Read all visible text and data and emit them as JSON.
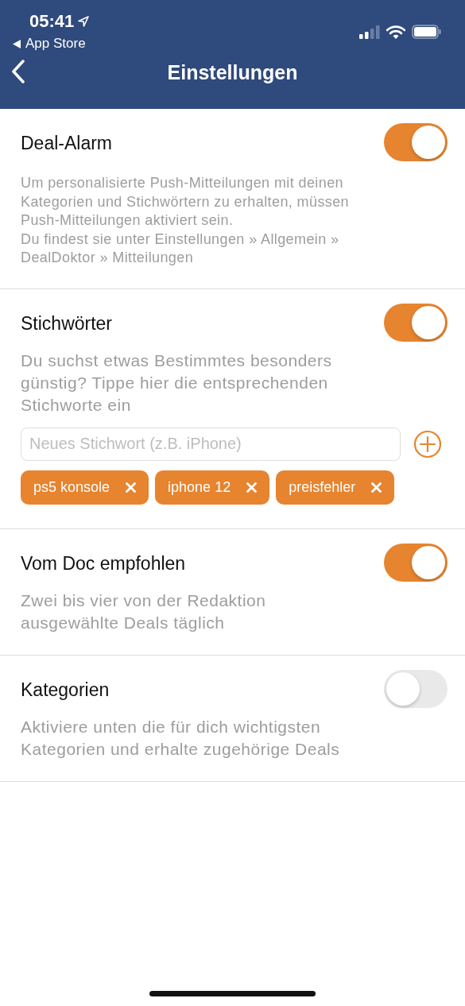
{
  "status_bar": {
    "time": "05:41",
    "back_app": "App Store"
  },
  "nav": {
    "title": "Einstellungen"
  },
  "sections": [
    {
      "kind": "notice",
      "title": "Deal-Alarm",
      "on": true,
      "description": "Um personalisierte Push-Mitteilungen mit deinen Kategorien und Stichwörtern zu erhalten, müssen Push-Mitteilungen aktiviert sein.\nDu findest sie unter Einstellungen » Allgemein » DealDoktor » Mitteilungen"
    },
    {
      "kind": "keywords",
      "title": "Stichwörter",
      "on": true,
      "description": "Du suchst etwas Bestimmtes besonders günstig? Tippe hier die entsprechenden Stichworte ein",
      "placeholder": "Neues Stichwort (z.B. iPhone)",
      "tags": [
        "ps5 konsole",
        "iphone 12",
        "preisfehler"
      ]
    },
    {
      "kind": "plain",
      "title": "Vom Doc empfohlen",
      "on": true,
      "description": "Zwei bis vier von der Redaktion ausgewählte Deals täglich"
    },
    {
      "kind": "plain",
      "title": "Kategorien",
      "on": false,
      "description": "Aktiviere unten die für dich wichtigsten Kategorien und erhalte zugehörige Deals"
    }
  ]
}
